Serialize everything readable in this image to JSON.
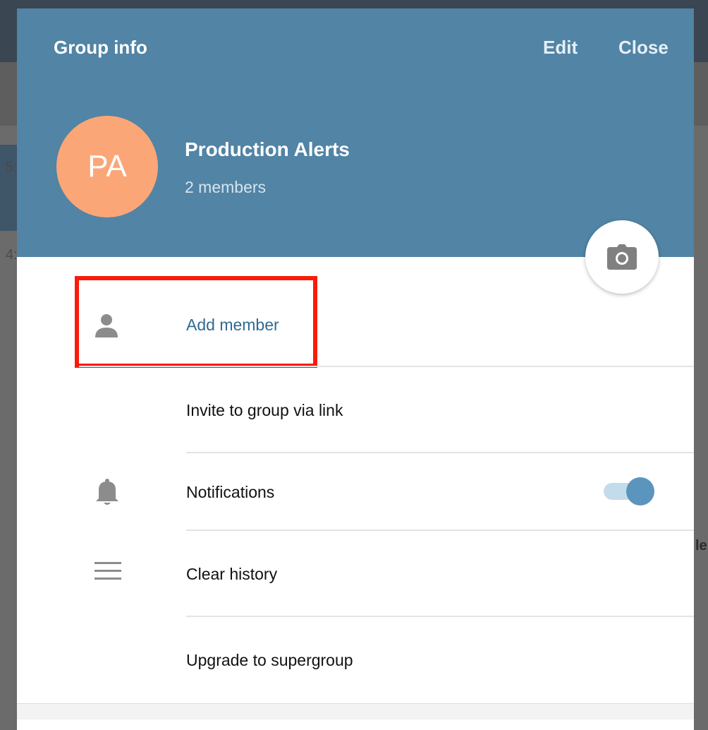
{
  "header": {
    "title": "Group info",
    "edit_label": "Edit",
    "close_label": "Close"
  },
  "group": {
    "initials": "PA",
    "name": "Production Alerts",
    "members": "2 members",
    "avatar_color": "#fba677"
  },
  "camera": {
    "icon": "camera-icon"
  },
  "menu": {
    "add_member": {
      "label": "Add member",
      "icon": "person-icon"
    },
    "invite_link": {
      "label": "Invite to group via link"
    },
    "notifications": {
      "label": "Notifications",
      "icon": "bell-icon",
      "enabled": true
    },
    "clear_history": {
      "label": "Clear history",
      "icon": "menu-lines-icon"
    },
    "upgrade": {
      "label": "Upgrade to supergroup"
    }
  },
  "background": {
    "fragments": [
      "5:",
      "4:",
      "le"
    ]
  },
  "colors": {
    "header": "#5184a5",
    "accent": "#2f6a93",
    "highlight": "#fb1a0a",
    "toggle_on": "#5b94bd"
  }
}
